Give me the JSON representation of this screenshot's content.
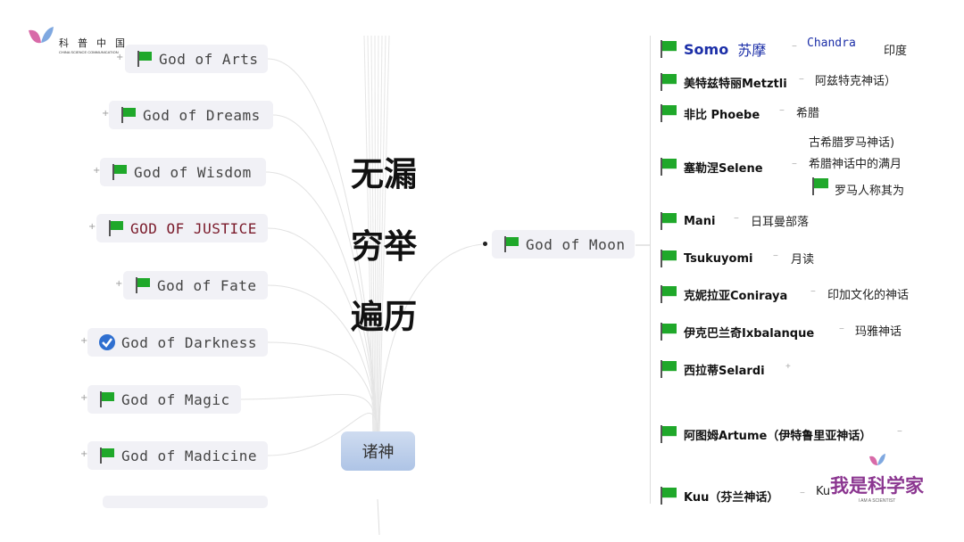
{
  "logo": {
    "text": "科普中国",
    "subtitle": "CHINA SCIENCE COMMUNICATION"
  },
  "watermark": {
    "text": "我是科学家",
    "subtitle": "I AM A SCIENTIST"
  },
  "overlay_text": [
    "无漏",
    "穷举",
    "遍历"
  ],
  "center_node": "诸神",
  "left_nodes": [
    {
      "label": "God of Arts",
      "icon": "flag-icon"
    },
    {
      "label": "God of Dreams",
      "icon": "flag-icon"
    },
    {
      "label": "God of Wisdom",
      "icon": "flag-icon"
    },
    {
      "label": "GOD OF JUSTICE",
      "icon": "flag-icon",
      "color": "#7a1a2a"
    },
    {
      "label": "God of Fate",
      "icon": "flag-icon"
    },
    {
      "label": "God of Darkness",
      "icon": "check-icon"
    },
    {
      "label": "God of Magic",
      "icon": "flag-icon"
    },
    {
      "label": "God of Madicine",
      "icon": "flag-icon"
    }
  ],
  "moon_node": "God of Moon",
  "moon_children": [
    {
      "label": "Somo",
      "label2": "苏摩",
      "notes": [
        "Chandra",
        "印度"
      ]
    },
    {
      "label": "美特兹特丽Metztli",
      "notes": [
        "阿兹特克神话）"
      ]
    },
    {
      "label": "非比 Phoebe",
      "notes": [
        "希腊"
      ]
    },
    {
      "label": "塞勒涅Selene",
      "notes": [
        "古希腊罗马神话)",
        "希腊神话中的满月",
        "罗马人称其为"
      ]
    },
    {
      "label": "Mani",
      "notes": [
        "日耳曼部落"
      ]
    },
    {
      "label": "Tsukuyomi",
      "notes": [
        "月读"
      ]
    },
    {
      "label": "克妮拉亚Coniraya",
      "notes": [
        "印加文化的神话"
      ]
    },
    {
      "label": "伊克巴兰奇Ixbalanque",
      "notes": [
        "玛雅神话"
      ]
    },
    {
      "label": "西拉蒂Selardi",
      "notes": []
    },
    {
      "label": "阿图姆Artume（伊特鲁里亚神话）",
      "notes": []
    },
    {
      "label": "Kuu（芬兰神话）",
      "notes": [
        "Ku"
      ]
    }
  ],
  "colors": {
    "flag": "#1fa82a",
    "somo": "#1c2fa8",
    "center": "#b8cbe8",
    "check": "#2f6fd0"
  }
}
